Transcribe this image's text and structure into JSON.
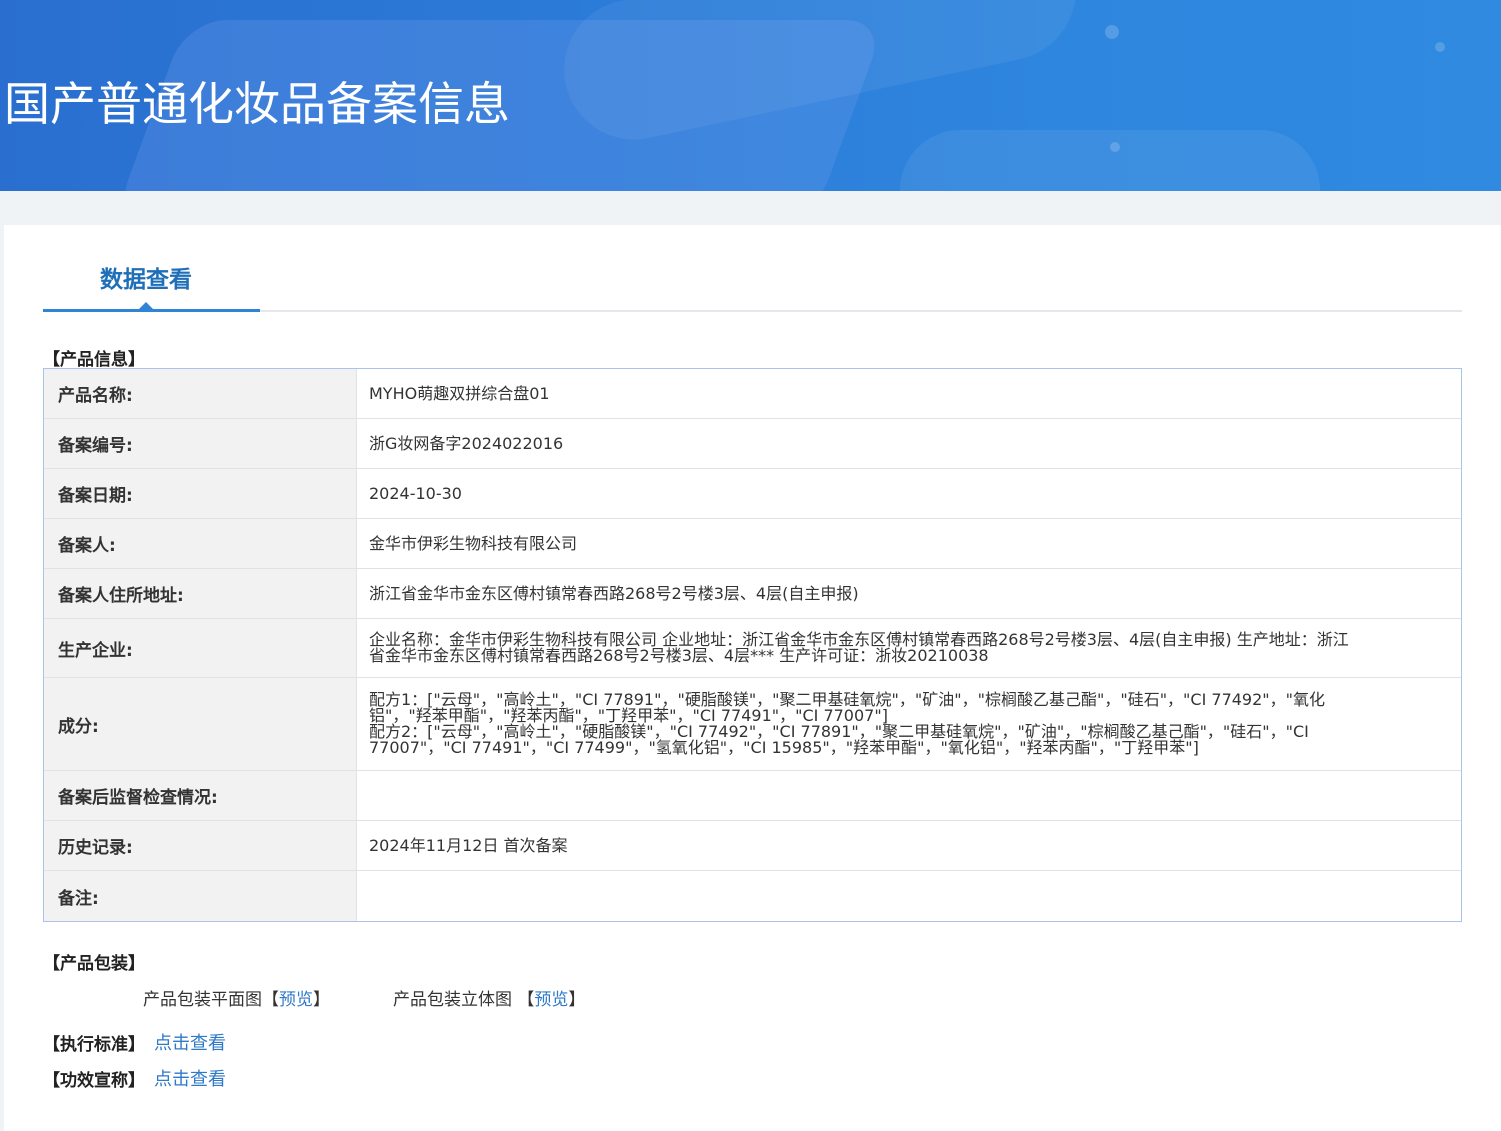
{
  "banner": {
    "title": "国产普通化妆品备案信息"
  },
  "tabs": [
    {
      "label": "数据查看"
    }
  ],
  "product_info": {
    "section_title": "【产品信息】",
    "rows": [
      {
        "label": "产品名称:",
        "value": "MYHO萌趣双拼综合盘01"
      },
      {
        "label": "备案编号:",
        "value": "浙G妆网备字2024022016"
      },
      {
        "label": "备案日期:",
        "value": "2024-10-30"
      },
      {
        "label": "备案人:",
        "value": "金华市伊彩生物科技有限公司"
      },
      {
        "label": "备案人住所地址:",
        "value": "浙江省金华市金东区傅村镇常春西路268号2号楼3层、4层(自主申报)"
      },
      {
        "label": "生产企业:",
        "lines": [
          "企业名称：金华市伊彩生物科技有限公司 企业地址：浙江省金华市金东区傅村镇常春西路268号2号楼3层、4层(自主申报) 生产地址：浙江",
          "省金华市金东区傅村镇常春西路268号2号楼3层、4层*** 生产许可证：浙妆20210038"
        ]
      },
      {
        "label": "成分:",
        "lines": [
          "配方1：[\"云母\"，\"高岭土\"，\"CI 77891\"，\"硬脂酸镁\"，\"聚二甲基硅氧烷\"，\"矿油\"，\"棕榈酸乙基己酯\"，\"硅石\"，\"CI 77492\"，\"氧化",
          "铝\"，\"羟苯甲酯\"，\"羟苯丙酯\"，\"丁羟甲苯\"，\"CI 77491\"，\"CI 77007\"]",
          "配方2：[\"云母\"，\"高岭土\"，\"硬脂酸镁\"，\"CI 77492\"，\"CI 77891\"，\"聚二甲基硅氧烷\"，\"矿油\"，\"棕榈酸乙基己酯\"，\"硅石\"，\"CI",
          "77007\"，\"CI 77491\"，\"CI 77499\"，\"氢氧化铝\"，\"CI 15985\"，\"羟苯甲酯\"，\"氧化铝\"，\"羟苯丙酯\"，\"丁羟甲苯\"]"
        ]
      },
      {
        "label": "备案后监督检查情况:",
        "value": ""
      },
      {
        "label": "历史记录:",
        "value": "2024年11月12日 首次备案"
      },
      {
        "label": "备注:",
        "value": ""
      }
    ]
  },
  "packaging": {
    "section_title": "【产品包装】",
    "flat_label": "产品包装平面图",
    "solid_label": "产品包装立体图",
    "bracket_open": "【",
    "bracket_close": "】",
    "preview": "预览"
  },
  "standard": {
    "section_title": "【执行标准】",
    "link": "点击查看"
  },
  "efficacy": {
    "section_title": "【功效宣称】",
    "link": "点击查看"
  }
}
